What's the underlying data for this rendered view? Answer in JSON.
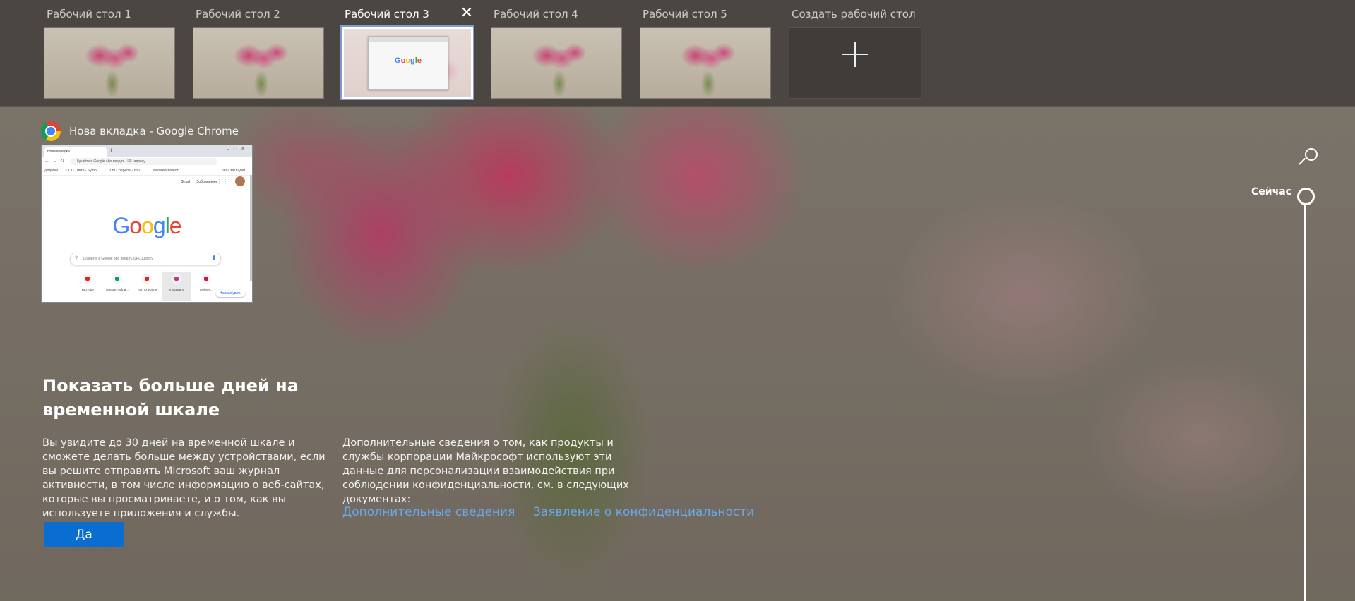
{
  "desktops": [
    {
      "label": "Рабочий стол 1"
    },
    {
      "label": "Рабочий стол 2"
    },
    {
      "label": "Рабочий стол 3",
      "active": true,
      "close_icon": "close-icon"
    },
    {
      "label": "Рабочий стол 4"
    },
    {
      "label": "Рабочий стол 5"
    }
  ],
  "new_desktop": {
    "label": "Создать рабочий стол",
    "icon": "plus-icon"
  },
  "window": {
    "title": "Нова вкладка - Google Chrome",
    "icon": "chrome-icon",
    "tab_title": "Нова вкладка",
    "url_placeholder": "Шукайте в Google або введіть URL-адресу",
    "bookmarks": [
      "Додатки",
      "UCI Culture - Symbi...",
      "Tum Cheparie - YouT...",
      "Web вебсвіжест"
    ],
    "bookmarks_other": "Інші закладки",
    "top_links": [
      "Gmail",
      "Зображення"
    ],
    "logo": {
      "g1": "G",
      "o1": "o",
      "o2": "o",
      "g2": "g",
      "l": "l",
      "e": "e"
    },
    "search_placeholder": "Шукайте в Google або введіть URL-адресу",
    "shortcuts": [
      {
        "label": "YouTube",
        "color": "#e62117"
      },
      {
        "label": "Google Табли...",
        "color": "#0f9d58"
      },
      {
        "label": "Tum Cheparie",
        "color": "#e62117"
      },
      {
        "label": "Instagram",
        "color": "#c13584"
      },
      {
        "label": "Deliver...",
        "color": "#c2185b"
      }
    ],
    "customize": "Налаштувати"
  },
  "timeline": {
    "now_label": "Сейчас",
    "search_icon": "search-icon"
  },
  "promo": {
    "title": "Показать больше дней на временной шкале",
    "body": "Вы увидите до 30 дней на временной шкале и сможете делать больше между устройствами, если вы решите отправить Microsoft ваш журнал активности, в том числе информацию о веб-сайтах, которые вы просматриваете, и о том, как вы используете приложения и службы.",
    "more_info": "Дополнительные сведения о том, как продукты и службы корпорации Майкрософт используют эти данные для персонализации взаимодействия при соблюдении конфиденциальности, см. в следующих документах:",
    "link_more": "Дополнительные сведения",
    "link_privacy": "Заявление о конфиденциальности",
    "yes_button": "Да"
  },
  "colors": {
    "accent": "#0a6ed1",
    "link": "#6aa8e8",
    "topbar": "#46423e"
  }
}
